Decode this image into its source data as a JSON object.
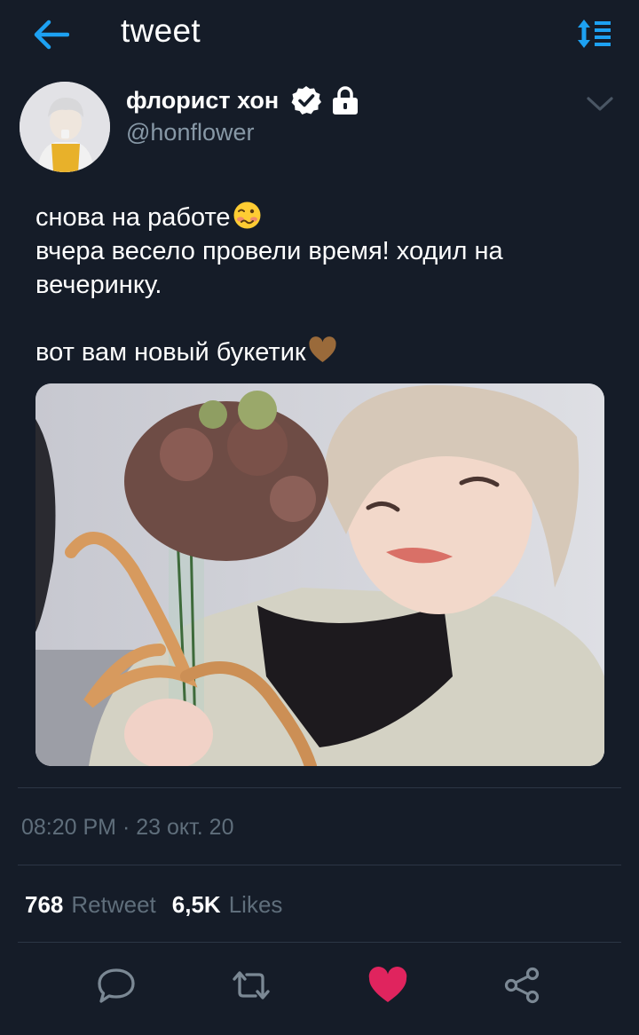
{
  "header": {
    "title": "tweet",
    "back_icon": "arrow-left-icon",
    "sort_icon": "sort-list-icon",
    "accent_color": "#1da1f2"
  },
  "author": {
    "display_name": "флорист хон",
    "handle": "@honflower",
    "verified_icon": "verified-badge-icon",
    "lock_icon": "lock-icon"
  },
  "tweet": {
    "lines": [
      "снова на работе",
      "вчера весело провели время! ходил на вечеринку.",
      "вот вам новый букетик"
    ],
    "emojis": [
      "woozy-face-emoji",
      "brown-heart-emoji"
    ]
  },
  "meta": {
    "timestamp": "08:20 PM · 23 окт. 20"
  },
  "stats": {
    "retweets_count": "768",
    "retweets_label": "Retweet",
    "likes_count": "6,5K",
    "likes_label": "Likes"
  },
  "actions": {
    "reply_icon": "reply-icon",
    "retweet_icon": "retweet-icon",
    "like_icon": "heart-icon",
    "share_icon": "share-icon",
    "like_color": "#e0245e"
  }
}
